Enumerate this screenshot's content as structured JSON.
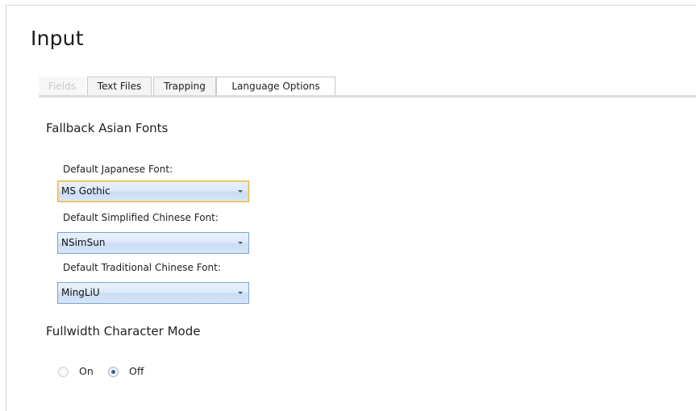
{
  "page": {
    "title": "Input"
  },
  "tabs": [
    {
      "label": "Fields",
      "state": "disabled"
    },
    {
      "label": "Text Files",
      "state": "normal"
    },
    {
      "label": "Trapping",
      "state": "normal"
    },
    {
      "label": "Language Options",
      "state": "selected"
    }
  ],
  "fallback_fonts": {
    "heading": "Fallback Asian Fonts",
    "japanese": {
      "label": "Default Japanese Font:",
      "value": "MS Gothic"
    },
    "simplified_chinese": {
      "label": "Default Simplified Chinese Font:",
      "value": "NSimSun"
    },
    "traditional_chinese": {
      "label": "Default Traditional Chinese Font:",
      "value": "MingLiU"
    }
  },
  "fullwidth": {
    "heading": "Fullwidth Character Mode",
    "options": [
      {
        "label": "On",
        "checked": false
      },
      {
        "label": "Off",
        "checked": true
      }
    ]
  },
  "colors": {
    "accent_focus": "#e8b44a",
    "combo_border": "#7da2ce",
    "radio_checked": "#3a5f96"
  }
}
